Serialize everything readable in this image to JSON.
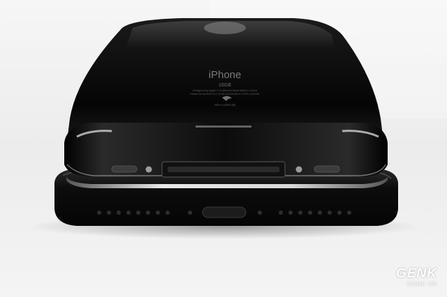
{
  "photo": {
    "subject": "old-iphone-stacked-on-new-iphone",
    "background_color": "#f2f2f2",
    "phone_color": "#0a0a0a"
  },
  "back_print": {
    "brand": "iPhone",
    "storage": "16GB",
    "line1": "Designed by Apple in California Assembled in China",
    "line2": "Model No A1303 FCC ID BCGA1303A IC 579C-A1303A",
    "compliance": "APA-A1303 (B)"
  },
  "watermark": {
    "brand": "GENK",
    "site": "GENK.VN"
  }
}
